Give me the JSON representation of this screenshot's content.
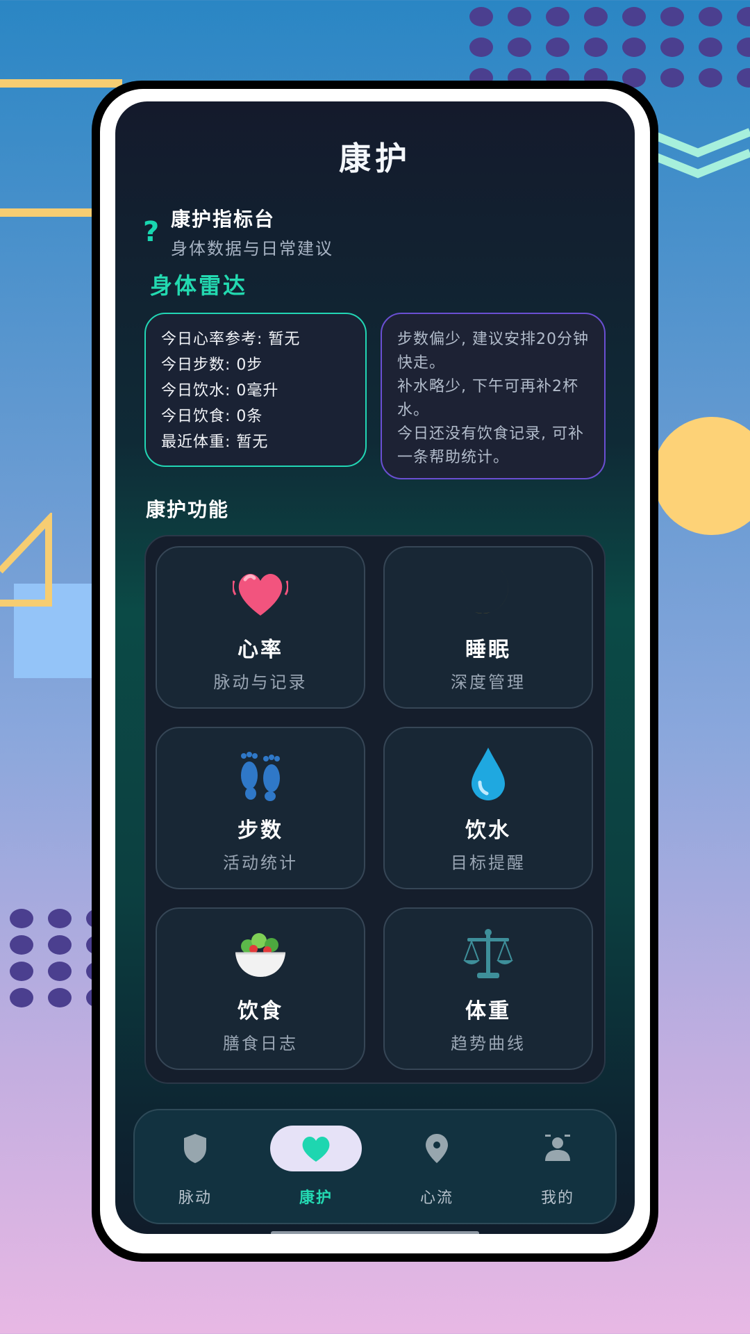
{
  "app": {
    "title": "康护",
    "header": {
      "icon": "question-icon",
      "icon_glyph": "?",
      "title": "康护指标台",
      "subtitle": "身体数据与日常建议"
    },
    "radar_title": "身体雷达",
    "stats": [
      "今日心率参考: 暂无",
      "今日步数: 0步",
      "今日饮水: 0毫升",
      "今日饮食: 0条",
      "最近体重: 暂无"
    ],
    "tips": [
      "步数偏少, 建议安排20分钟快走。",
      "补水略少, 下午可再补2杯水。",
      "今日还没有饮食记录, 可补一条帮助统计。"
    ],
    "functions_title": "康护功能",
    "functions": [
      {
        "icon": "heart-icon",
        "title": "心率",
        "subtitle": "脉动与记录"
      },
      {
        "icon": "moon-icon",
        "title": "睡眠",
        "subtitle": "深度管理"
      },
      {
        "icon": "footprints-icon",
        "title": "步数",
        "subtitle": "活动统计"
      },
      {
        "icon": "water-drop-icon",
        "title": "饮水",
        "subtitle": "目标提醒"
      },
      {
        "icon": "salad-icon",
        "title": "饮食",
        "subtitle": "膳食日志"
      },
      {
        "icon": "scale-icon",
        "title": "体重",
        "subtitle": "趋势曲线"
      }
    ],
    "nav": [
      {
        "icon": "shield-icon",
        "label": "脉动",
        "active": false
      },
      {
        "icon": "heart-icon",
        "label": "康护",
        "active": true
      },
      {
        "icon": "location-pin-icon",
        "label": "心流",
        "active": false
      },
      {
        "icon": "person-icon",
        "label": "我的",
        "active": false
      }
    ]
  },
  "colors": {
    "accent": "#22d6b4",
    "tip_border": "#6a4fd2",
    "nav_active_bg": "#e6e2f7"
  }
}
